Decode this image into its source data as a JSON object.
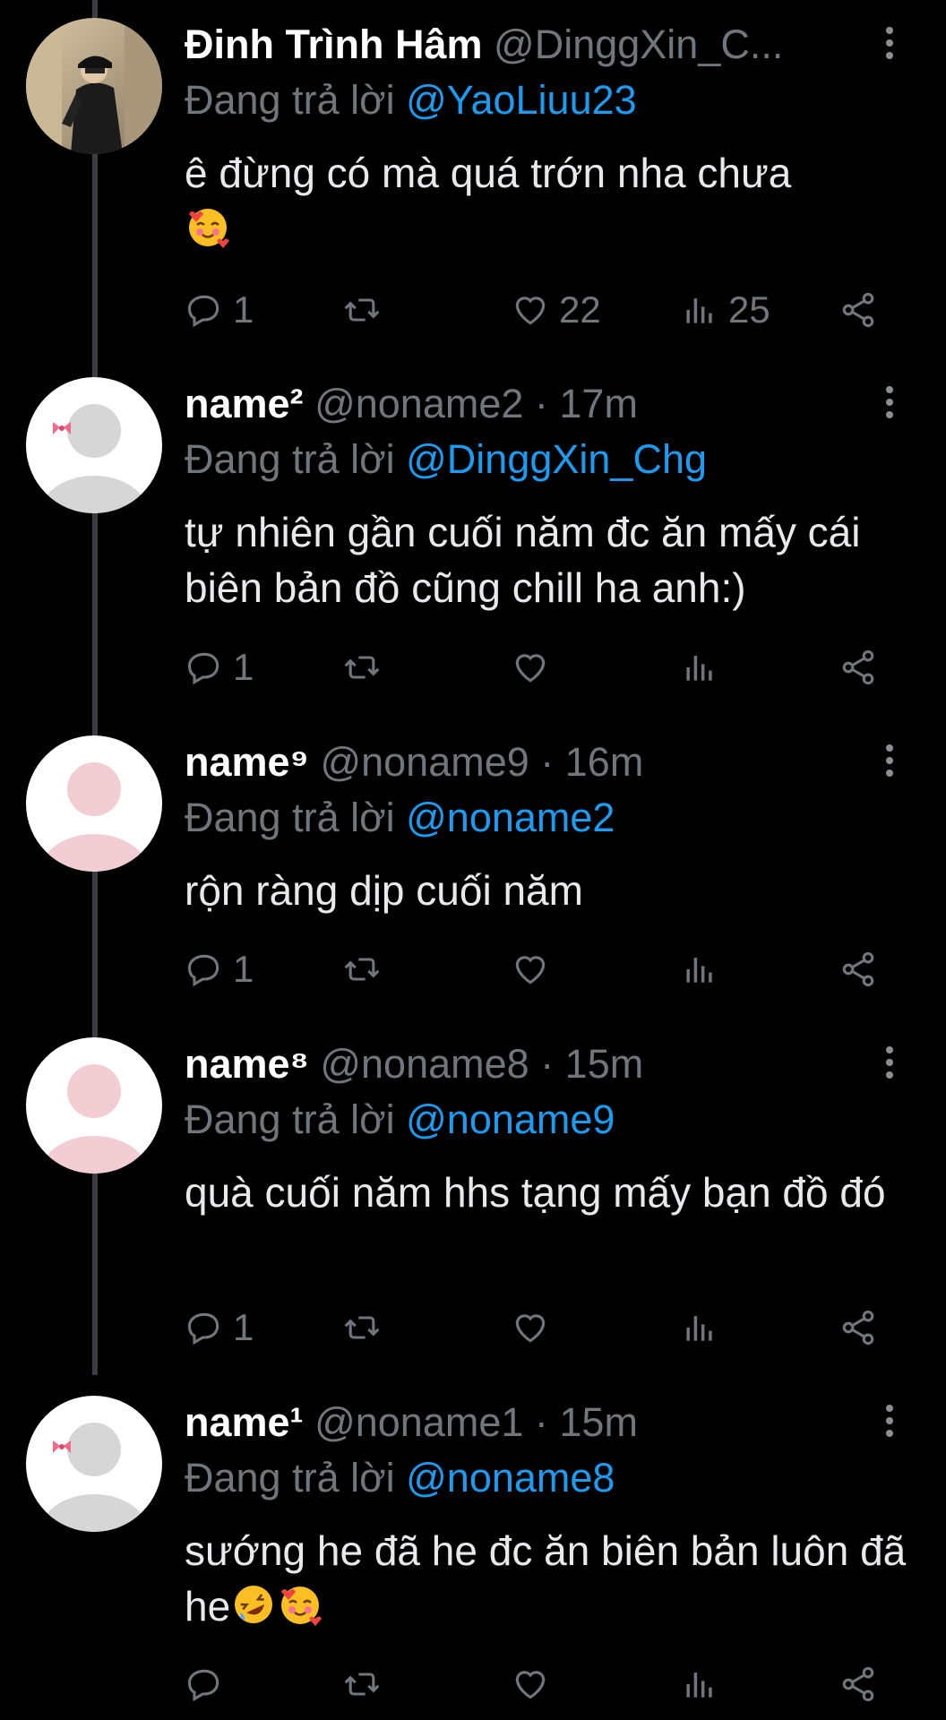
{
  "replying_label": "Đang trả lời",
  "tweets": [
    {
      "name": "Đinh Trình Hâm",
      "handle": "@DinggXin_C...",
      "time": "",
      "reply_to": "@YaoLiuu23",
      "text": "ê đừng có mà quá trớn nha chưa",
      "text_line2_emoji": "🥰",
      "stats": {
        "replies": "1",
        "retweets": "",
        "likes": "22",
        "views": "25"
      },
      "avatar": "photo-avatar"
    },
    {
      "name": "name²",
      "handle": "@noname2",
      "time": "· 17m",
      "reply_to": "@DinggXin_Chg",
      "text": "tự nhiên gần cuối năm đc ăn mấy cái biên bản đồ cũng chill ha anh:)",
      "stats": {
        "replies": "1",
        "retweets": "",
        "likes": "",
        "views": ""
      },
      "avatar": "default-gray-bow"
    },
    {
      "name": "name⁹",
      "handle": "@noname9",
      "time": "· 16m",
      "reply_to": "@noname2",
      "text": "rộn ràng dịp cuối năm",
      "stats": {
        "replies": "1",
        "retweets": "",
        "likes": "",
        "views": ""
      },
      "avatar": "default-pink"
    },
    {
      "name": "name⁸",
      "handle": "@noname8",
      "time": "· 15m",
      "reply_to": "@noname9",
      "text": "quà cuối năm hhs tạng mấy bạn đồ đó",
      "stats": {
        "replies": "1",
        "retweets": "",
        "likes": "",
        "views": ""
      },
      "avatar": "default-pink"
    },
    {
      "name": "name¹",
      "handle": "@noname1",
      "time": "· 15m",
      "reply_to": "@noname8",
      "text": "sướng he đã he đc ăn biên bản luôn đã he",
      "text_emojis": "🤣🥰",
      "stats": {
        "replies": "",
        "retweets": "",
        "likes": "",
        "views": ""
      },
      "avatar": "default-gray-bow"
    }
  ],
  "colors": {
    "background": "#000000",
    "text": "#e7e9ea",
    "muted": "#71767b",
    "link": "#1d9bf0",
    "thread_line": "#3a3d41"
  },
  "icons": [
    "more-vertical-icon",
    "reply-icon",
    "retweet-icon",
    "like-icon",
    "views-icon",
    "share-icon",
    "bow-icon"
  ]
}
